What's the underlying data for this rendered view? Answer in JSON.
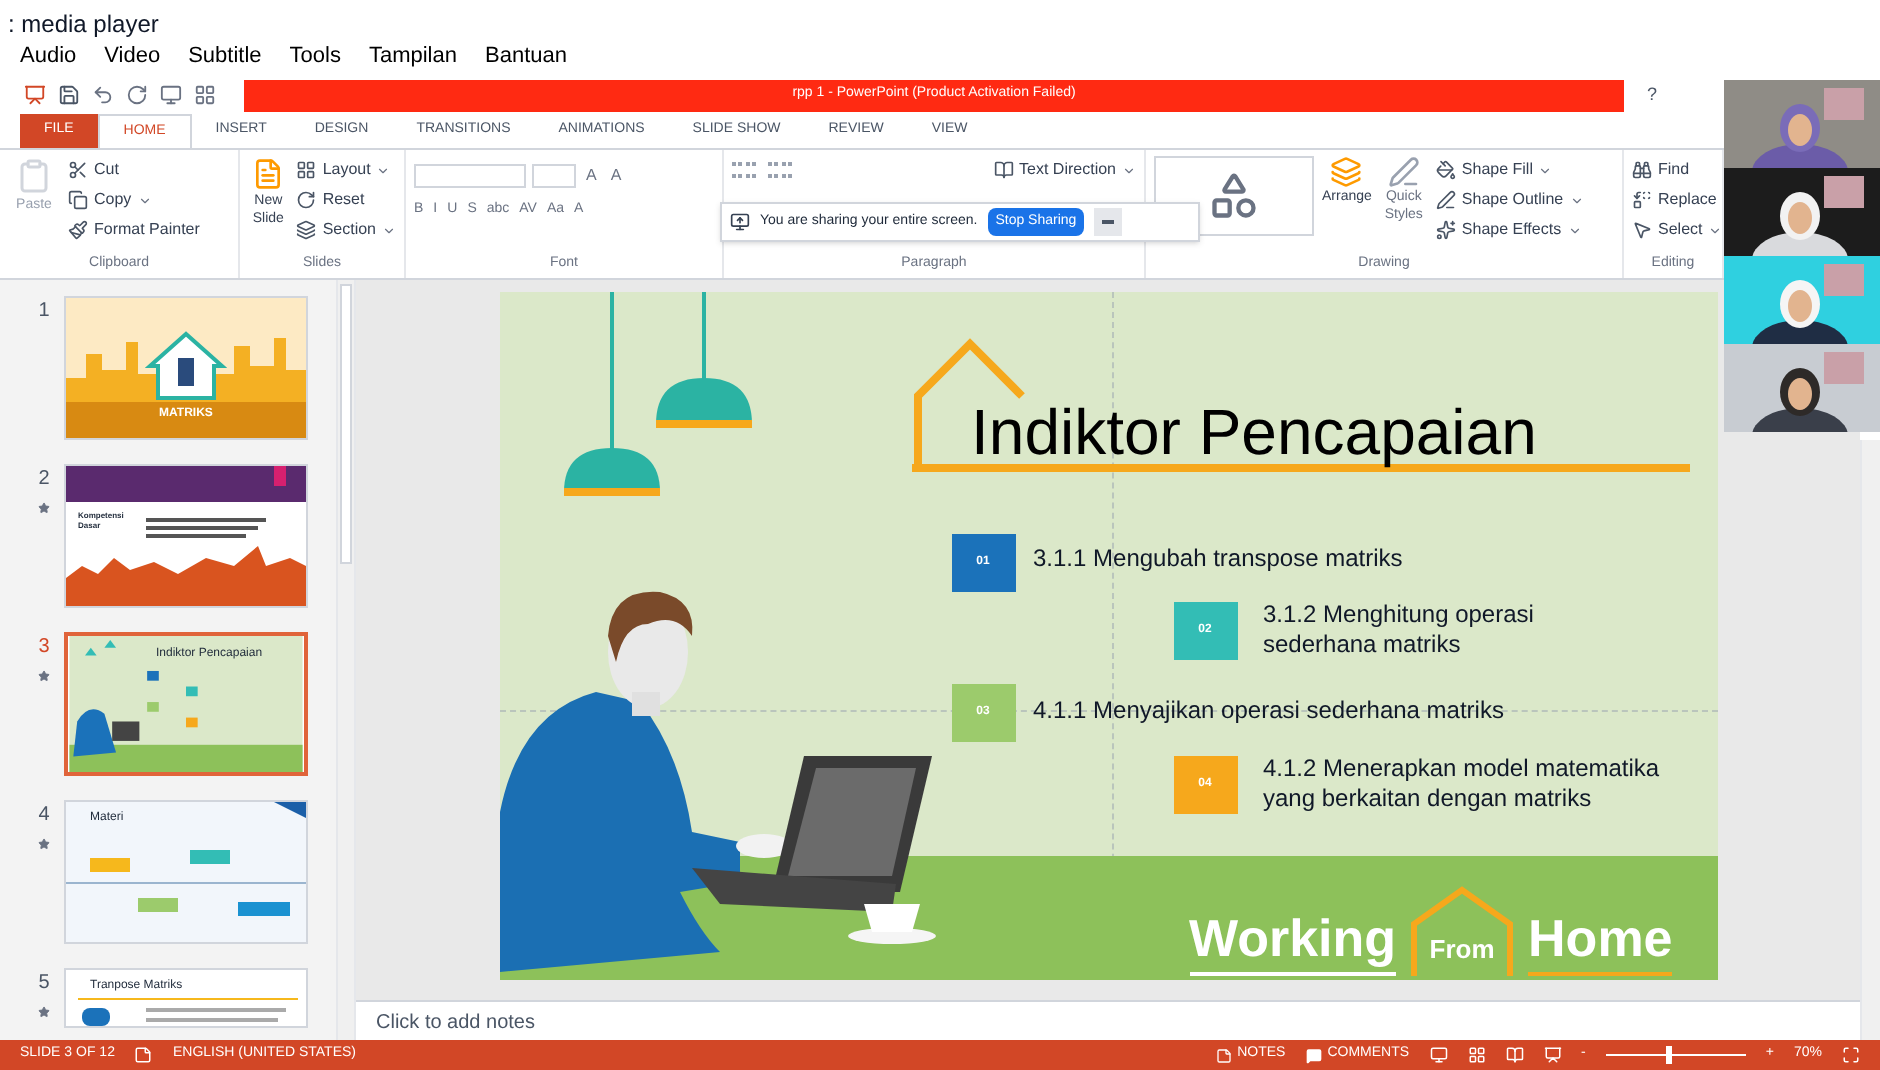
{
  "player": {
    "title": ": media player",
    "menu": [
      "Audio",
      "Video",
      "Subtitle",
      "Tools",
      "Tampilan",
      "Bantuan"
    ]
  },
  "window": {
    "title": "rpp 1 - PowerPoint (Product Activation Failed)",
    "help": "?"
  },
  "tabs": [
    {
      "label": "FILE",
      "kind": "file",
      "selected": false
    },
    {
      "label": "HOME",
      "kind": "tab",
      "selected": true
    },
    {
      "label": "INSERT",
      "kind": "tab",
      "selected": false
    },
    {
      "label": "DESIGN",
      "kind": "tab",
      "selected": false
    },
    {
      "label": "TRANSITIONS",
      "kind": "tab",
      "selected": false
    },
    {
      "label": "ANIMATIONS",
      "kind": "tab",
      "selected": false
    },
    {
      "label": "SLIDE SHOW",
      "kind": "tab",
      "selected": false
    },
    {
      "label": "REVIEW",
      "kind": "tab",
      "selected": false
    },
    {
      "label": "VIEW",
      "kind": "tab",
      "selected": false
    }
  ],
  "clipboard": {
    "label": "Clipboard",
    "paste": {
      "text": "Paste",
      "disabled": true
    },
    "cut": "Cut",
    "copy": "Copy",
    "format_painter": "Format Painter"
  },
  "slides_group": {
    "label": "Slides",
    "new_slide": "New Slide",
    "layout": "Layout",
    "reset": "Reset",
    "section": "Section"
  },
  "font": {
    "label": "Font",
    "size_buttons": [
      "A",
      "A"
    ],
    "buttons": [
      "B",
      "I",
      "U",
      "S",
      "abc",
      "AV",
      "Aa",
      "A"
    ]
  },
  "paragraph": {
    "label": "Paragraph",
    "text_direction": "Text Direction"
  },
  "drawing": {
    "label": "Drawing",
    "arrange": "Arrange",
    "quick_styles": "Quick Styles",
    "shape_fill": "Shape Fill",
    "shape_outline": "Shape Outline",
    "shape_effects": "Shape Effects"
  },
  "editing": {
    "label": "Editing",
    "find": "Find",
    "replace": "Replace",
    "select": "Select"
  },
  "share_banner": {
    "message": "You are sharing your entire screen.",
    "button": "Stop Sharing"
  },
  "thumbnails": [
    {
      "number": "1",
      "kind": "cover",
      "title": "MATRIKS",
      "animated": false,
      "selected": false
    },
    {
      "number": "2",
      "kind": "city",
      "title": "Kompetensi Dasar",
      "animated": true,
      "selected": false
    },
    {
      "number": "3",
      "kind": "indicators",
      "title": "Indiktor Pencapaian",
      "animated": true,
      "selected": true
    },
    {
      "number": "4",
      "kind": "timeline",
      "title": "Materi",
      "animated": true,
      "selected": false
    },
    {
      "number": "5",
      "kind": "content",
      "title": "Tranpose Matriks",
      "animated": true,
      "selected": false
    }
  ],
  "slide": {
    "title": "Indiktor Pencapaian",
    "items": [
      {
        "number": "01",
        "text": "3.1.1 Mengubah transpose matriks",
        "color": "#1b72ba"
      },
      {
        "number": "02",
        "text": "3.1.2 Menghitung operasi sederhana matriks",
        "color": "#33bdb5"
      },
      {
        "number": "03",
        "text": "4.1.1 Menyajikan operasi sederhana matriks",
        "color": "#9ccb6c"
      },
      {
        "number": "04",
        "text": "4.1.2 Menerapkan model matematika yang berkaitan dengan matriks",
        "color": "#f6a81c"
      }
    ],
    "footer": [
      "Working",
      "From",
      "Home"
    ]
  },
  "notes": {
    "placeholder": "Click to add notes"
  },
  "status_bar": {
    "slide": "SLIDE 3 OF 12",
    "language": "ENGLISH (UNITED STATES)",
    "notes": "NOTES",
    "comments": "COMMENTS",
    "zoom": {
      "minus": "-",
      "plus": "+",
      "level": 0.45,
      "reading": "70%"
    }
  }
}
